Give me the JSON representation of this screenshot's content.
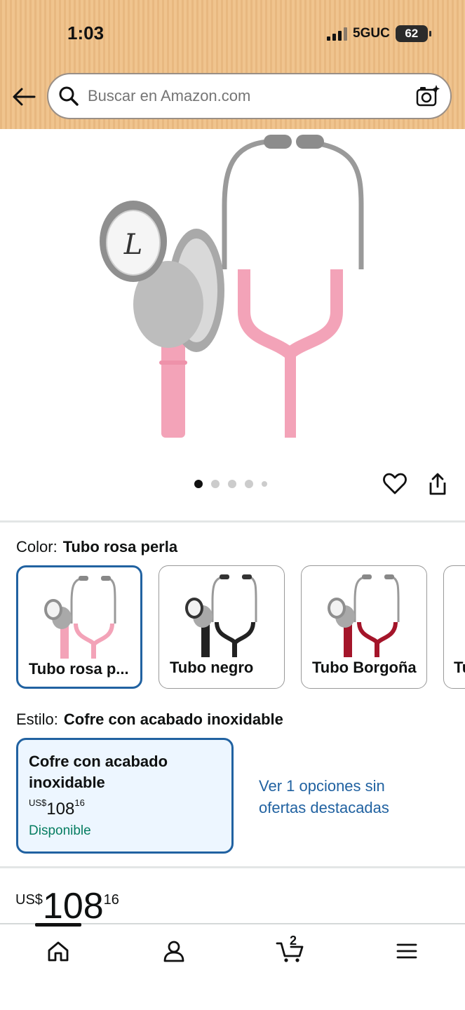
{
  "status_bar": {
    "time": "1:03",
    "network": "5GUC",
    "battery": "62"
  },
  "search": {
    "placeholder": "Buscar en Amazon.com"
  },
  "gallery": {
    "image_count": 5,
    "active_index": 0
  },
  "color": {
    "label": "Color:",
    "selected": "Tubo rosa perla",
    "options": [
      {
        "label": "Tubo rosa p...",
        "tube_color": "#f3a3b8"
      },
      {
        "label": "Tubo negro",
        "tube_color": "#222222"
      },
      {
        "label": "Tubo Borgoña",
        "tube_color": "#a4152a"
      },
      {
        "label": "Tu",
        "tube_color": "#1b2b5a"
      }
    ]
  },
  "style": {
    "label": "Estilo:",
    "selected": "Cofre con acabado inoxidable",
    "card": {
      "name_line1": "Cofre con acabado",
      "name_line2": "inoxidable",
      "currency": "US$",
      "whole": "108",
      "fraction": "16",
      "availability": "Disponible"
    },
    "see_more_line1": "Ver 1 opciones sin",
    "see_more_line2": "ofertas destacadas"
  },
  "price": {
    "currency": "US$",
    "whole": "108",
    "fraction": "16"
  },
  "bottom_nav": {
    "cart_count": "2"
  },
  "colors": {
    "link": "#2162a1",
    "available": "#067d62",
    "pink_tube": "#f3a3b8"
  }
}
